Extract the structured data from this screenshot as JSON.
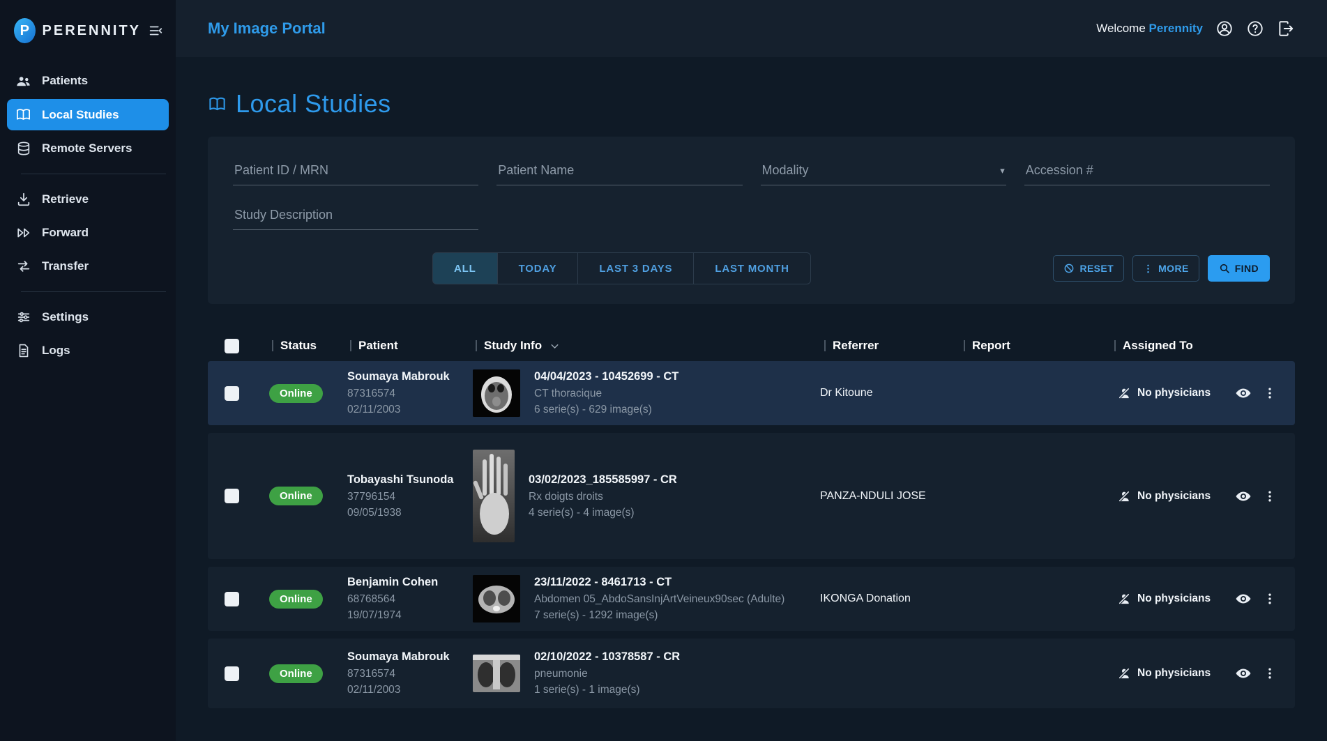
{
  "app": {
    "brand": "PERENNITY",
    "header_title": "My Image Portal",
    "welcome_prefix": "Welcome",
    "welcome_user": "Perennity"
  },
  "colors": {
    "accent": "#2F9BEA",
    "status_online": "#3EA144",
    "find_button": "#2B9CF0",
    "active_nav": "#1E8FE8"
  },
  "sidebar": {
    "items": [
      {
        "label": "Patients"
      },
      {
        "label": "Local Studies",
        "active": true
      },
      {
        "label": "Remote Servers"
      },
      {
        "label": "Retrieve"
      },
      {
        "label": "Forward"
      },
      {
        "label": "Transfer"
      },
      {
        "label": "Settings"
      },
      {
        "label": "Logs"
      }
    ]
  },
  "page": {
    "title": "Local Studies"
  },
  "filters": {
    "patient_id_placeholder": "Patient ID / MRN",
    "patient_name_placeholder": "Patient Name",
    "modality_label": "Modality",
    "accession_placeholder": "Accession #",
    "study_description_placeholder": "Study Description",
    "date_buttons": [
      "ALL",
      "TODAY",
      "LAST 3 DAYS",
      "LAST MONTH"
    ],
    "active_date_button": "ALL",
    "reset_label": "RESET",
    "more_label": "MORE",
    "find_label": "FIND"
  },
  "table": {
    "columns": [
      "Status",
      "Patient",
      "Study Info",
      "Referrer",
      "Report",
      "Assigned To"
    ],
    "rows": [
      {
        "status": "Online",
        "patient_name": "Soumaya Mabrouk",
        "patient_id": "87316574",
        "patient_dob": "02/11/2003",
        "study_title": "04/04/2023 - 10452699 - CT",
        "study_description": "CT thoracique",
        "study_counts": "6 serie(s) - 629 image(s)",
        "referrer": "Dr Kitoune",
        "report": "",
        "assigned_to": "No physicians",
        "selected": true
      },
      {
        "status": "Online",
        "patient_name": "Tobayashi Tsunoda",
        "patient_id": "37796154",
        "patient_dob": "09/05/1938",
        "study_title": "03/02/2023_185585997 - CR",
        "study_description": "Rx doigts droits",
        "study_counts": "4 serie(s) - 4 image(s)",
        "referrer": "PANZA-NDULI JOSE",
        "report": "",
        "assigned_to": "No physicians",
        "selected": false
      },
      {
        "status": "Online",
        "patient_name": "Benjamin Cohen",
        "patient_id": "68768564",
        "patient_dob": "19/07/1974",
        "study_title": "23/11/2022 - 8461713 - CT",
        "study_description": "Abdomen 05_AbdoSansInjArtVeineux90sec (Adulte)",
        "study_counts": "7 serie(s) - 1292 image(s)",
        "referrer": "IKONGA Donation",
        "report": "",
        "assigned_to": "No physicians",
        "selected": false
      },
      {
        "status": "Online",
        "patient_name": "Soumaya Mabrouk",
        "patient_id": "87316574",
        "patient_dob": "02/11/2003",
        "study_title": "02/10/2022 - 10378587 - CR",
        "study_description": "pneumonie",
        "study_counts": "1 serie(s) - 1 image(s)",
        "referrer": "",
        "report": "",
        "assigned_to": "No physicians",
        "selected": false
      }
    ]
  }
}
